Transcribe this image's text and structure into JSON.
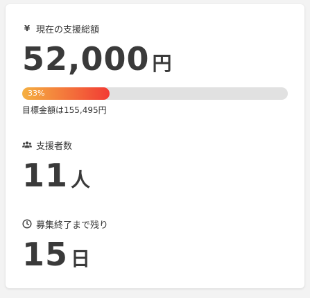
{
  "funding": {
    "label": "現在の支援総額",
    "icon": "yen-icon",
    "amount": "52,000",
    "unit": "円",
    "progress_percent": 33,
    "progress_label": "33%",
    "goal_text": "目標金額は155,495円",
    "progress_colors": [
      "#f5b041",
      "#f23b34"
    ]
  },
  "supporters": {
    "label": "支援者数",
    "icon": "users-icon",
    "count": "11",
    "unit": "人"
  },
  "remaining": {
    "label": "募集終了まで残り",
    "icon": "clock-icon",
    "count": "15",
    "unit": "日"
  }
}
